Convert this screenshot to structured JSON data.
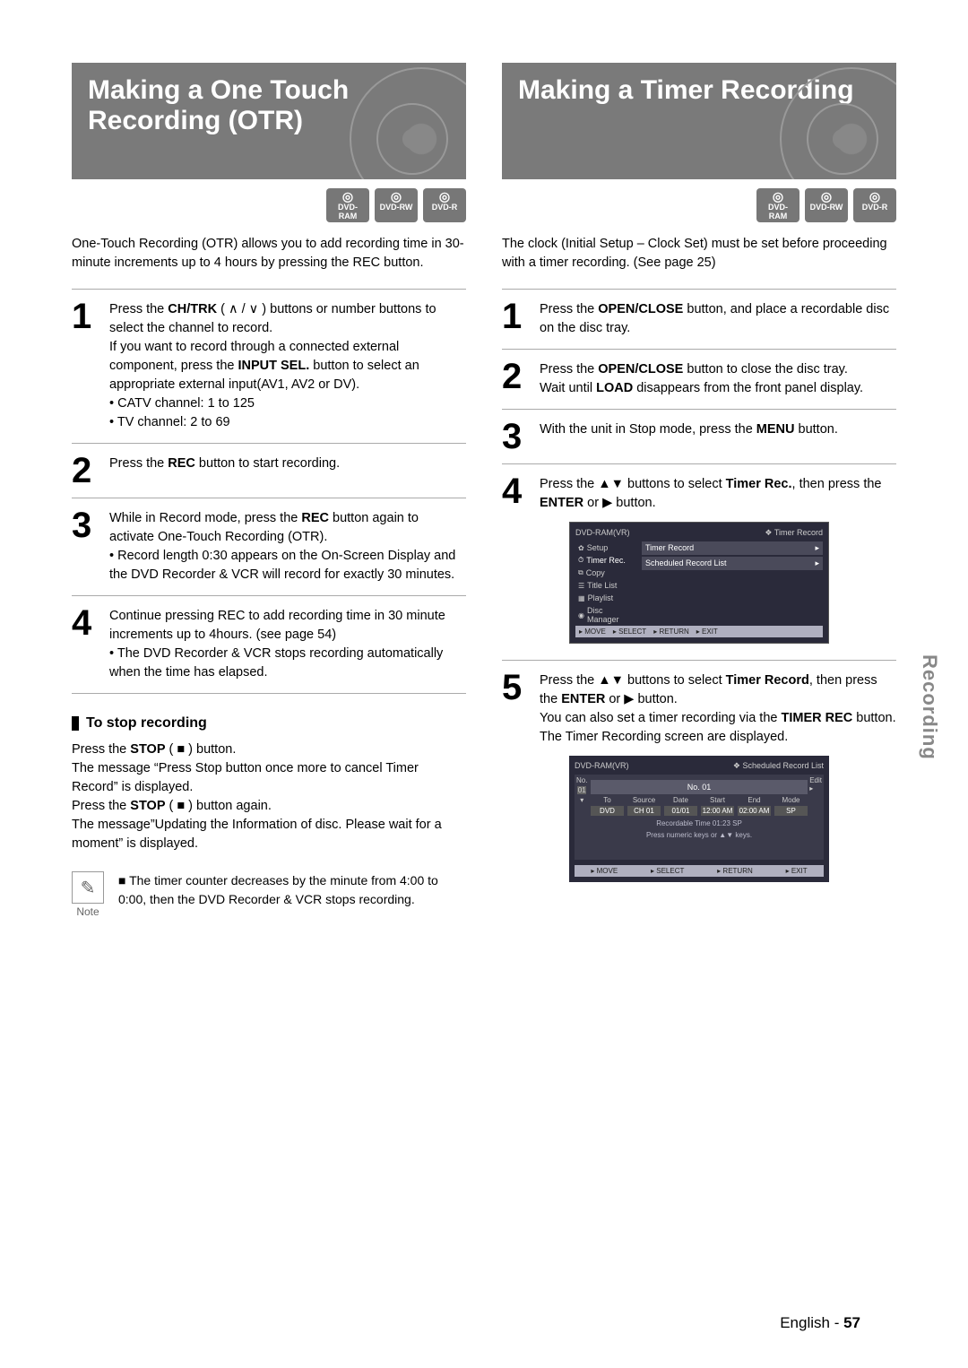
{
  "sideTab": "Recording",
  "footer": {
    "lang": "English",
    "sep": " - ",
    "page": "57"
  },
  "left": {
    "title": "Making a One Touch Recording (OTR)",
    "badges": [
      "DVD-RAM",
      "DVD-RW",
      "DVD-R"
    ],
    "intro": "One-Touch Recording (OTR) allows you to add recording time in 30-minute increments up to 4 hours by pressing the REC button.",
    "steps": [
      {
        "num": "1",
        "html": "Press the <b>CH/TRK</b> ( ∧ / ∨ ) buttons or number buttons to select the channel to record.\nIf you want to record through a connected external component, press the <b>INPUT SEL.</b> button to select an appropriate external input(AV1, AV2 or DV).\n• CATV channel: 1 to 125\n• TV channel: 2 to 69"
      },
      {
        "num": "2",
        "html": "Press the <b>REC</b> button to start recording."
      },
      {
        "num": "3",
        "html": "While in Record mode, press the <b>REC</b> button again to activate One-Touch Recording (OTR).\n• Record length 0:30 appears on the On-Screen Display and the DVD Recorder & VCR will record for exactly 30 minutes."
      },
      {
        "num": "4",
        "html": "Continue pressing REC to add recording time in 30 minute increments up to 4hours. (see page 54)\n• The DVD Recorder & VCR stops recording automatically when the time has elapsed."
      }
    ],
    "stopHead": "To stop recording",
    "stopBody": "Press the <b>STOP</b> ( ■ ) button.\nThe message “Press Stop button once more to cancel Timer Record” is displayed.\nPress the <b>STOP</b> ( ■ ) button again.\nThe message”Updating the Information of disc. Please wait for a moment” is displayed.",
    "noteLabel": "Note",
    "noteBody": "The timer counter decreases by the minute from 4:00 to 0:00, then the DVD Recorder & VCR stops recording."
  },
  "right": {
    "title": "Making a Timer Recording",
    "badges": [
      "DVD-RAM",
      "DVD-RW",
      "DVD-R"
    ],
    "intro": "The clock (Initial Setup – Clock Set) must be set before proceeding with a timer recording. (See page 25)",
    "steps": [
      {
        "num": "1",
        "html": "Press the <b>OPEN/CLOSE</b> button, and place a recordable disc on the disc tray."
      },
      {
        "num": "2",
        "html": "Press the <b>OPEN/CLOSE</b> button to close the disc tray.\nWait until <b>LOAD</b> disappears from the front panel display."
      },
      {
        "num": "3",
        "html": "With the unit in Stop mode, press the <b>MENU</b> button."
      },
      {
        "num": "4",
        "html": "Press the ▲▼  buttons to select <b>Timer Rec.</b>, then press the <b>ENTER</b> or ▶ button."
      },
      {
        "num": "5",
        "html": "Press the ▲▼ buttons to select <b>Timer Record</b>, then press the <b>ENTER</b> or ▶ button.\nYou can also set a timer recording via the <b>TIMER REC</b> button.\nThe Timer Recording screen are displayed."
      }
    ],
    "osd1": {
      "topLeft": "DVD-RAM(VR)",
      "topRight": "Timer Record",
      "side": [
        "Setup",
        "Timer Rec.",
        "Copy",
        "Title List",
        "Playlist",
        "Disc Manager"
      ],
      "rows": [
        "Timer Record",
        "Scheduled Record List"
      ],
      "bottom": [
        "MOVE",
        "SELECT",
        "RETURN",
        "EXIT"
      ]
    },
    "osd2": {
      "topLeft": "DVD-RAM(VR)",
      "topRight": "Scheduled Record List",
      "no": "No.",
      "edit": "Edit",
      "boxTitle": "No. 01",
      "cols": [
        "To",
        "Source",
        "Date",
        "Start",
        "End",
        "Mode"
      ],
      "vals": [
        "DVD",
        "CH 01",
        "01/01",
        "12:00 AM",
        "02:00 AM",
        "SP"
      ],
      "msg1": "Recordable Time 01:23 SP",
      "msg2": "Press numeric keys or ▲▼ keys.",
      "leftNums": [
        "01"
      ],
      "bottom": [
        "MOVE",
        "SELECT",
        "RETURN",
        "EXIT"
      ]
    }
  }
}
